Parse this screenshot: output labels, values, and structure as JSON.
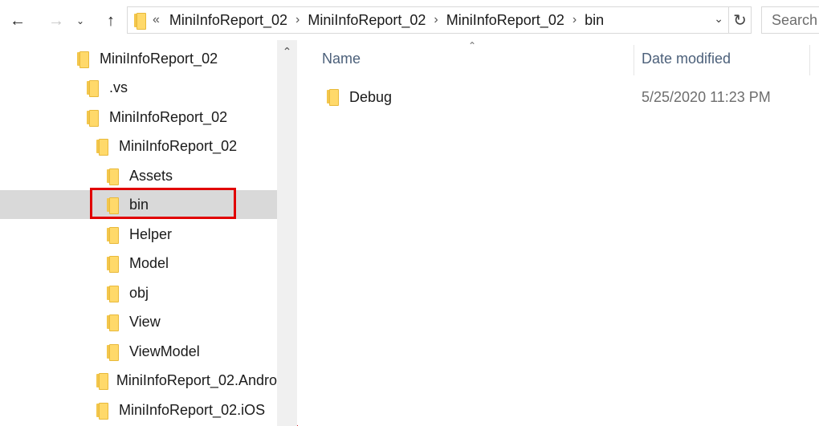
{
  "toolbar": {
    "back_icon": "arrow-left-icon",
    "forward_icon": "arrow-right-icon",
    "recent_icon": "chevron-down-icon",
    "up_icon": "arrow-up-icon",
    "overflow": "«",
    "breadcrumb": [
      "MiniInfoReport_02",
      "MiniInfoReport_02",
      "MiniInfoReport_02",
      "bin"
    ],
    "search_placeholder": "Search"
  },
  "nav_tree": [
    {
      "label": "MiniInfoReport_02"
    },
    {
      "label": ".vs"
    },
    {
      "label": "MiniInfoReport_02"
    },
    {
      "label": "MiniInfoReport_02"
    },
    {
      "label": "Assets"
    },
    {
      "label": "bin",
      "selected": true
    },
    {
      "label": "Helper"
    },
    {
      "label": "Model"
    },
    {
      "label": "obj"
    },
    {
      "label": "View"
    },
    {
      "label": "ViewModel"
    },
    {
      "label": "MiniInfoReport_02.Andro"
    },
    {
      "label": "MiniInfoReport_02.iOS"
    }
  ],
  "columns": {
    "name": "Name",
    "date": "Date modified"
  },
  "files": [
    {
      "name": "Debug",
      "date": "5/25/2020 11:23 PM"
    }
  ],
  "colors": {
    "highlight": "#e10000",
    "selected_bg": "#d9d9d9",
    "header_text": "#4c607a",
    "folder": "#ffd96a"
  }
}
